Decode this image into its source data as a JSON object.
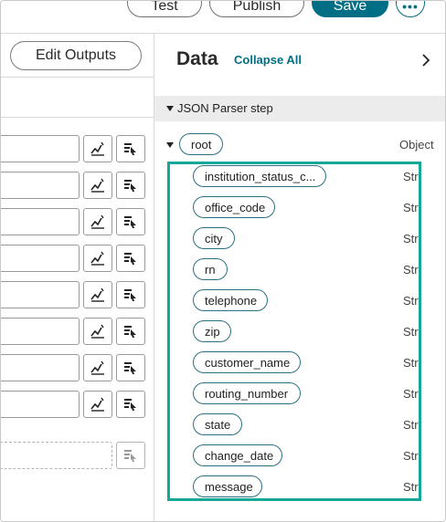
{
  "toolbar": {
    "test_label": "Test",
    "publish_label": "Publish",
    "save_label": "Save",
    "more_label": "•••"
  },
  "left_panel": {
    "edit_outputs_label": "Edit Outputs"
  },
  "right_panel": {
    "title": "Data",
    "collapse_all_label": "Collapse All",
    "step_label": "JSON Parser step",
    "root": {
      "name": "root",
      "type": "Object"
    },
    "fields": [
      {
        "name": "institution_status_c...",
        "type": "String"
      },
      {
        "name": "office_code",
        "type": "String"
      },
      {
        "name": "city",
        "type": "String"
      },
      {
        "name": "rn",
        "type": "String"
      },
      {
        "name": "telephone",
        "type": "String"
      },
      {
        "name": "zip",
        "type": "String"
      },
      {
        "name": "customer_name",
        "type": "String"
      },
      {
        "name": "routing_number",
        "type": "String"
      },
      {
        "name": "state",
        "type": "String"
      },
      {
        "name": "change_date",
        "type": "String"
      },
      {
        "name": "message",
        "type": "String"
      }
    ]
  },
  "colors": {
    "accent": "#006f85",
    "highlight_border": "#14a898",
    "pill_border": "#2b6f82"
  }
}
